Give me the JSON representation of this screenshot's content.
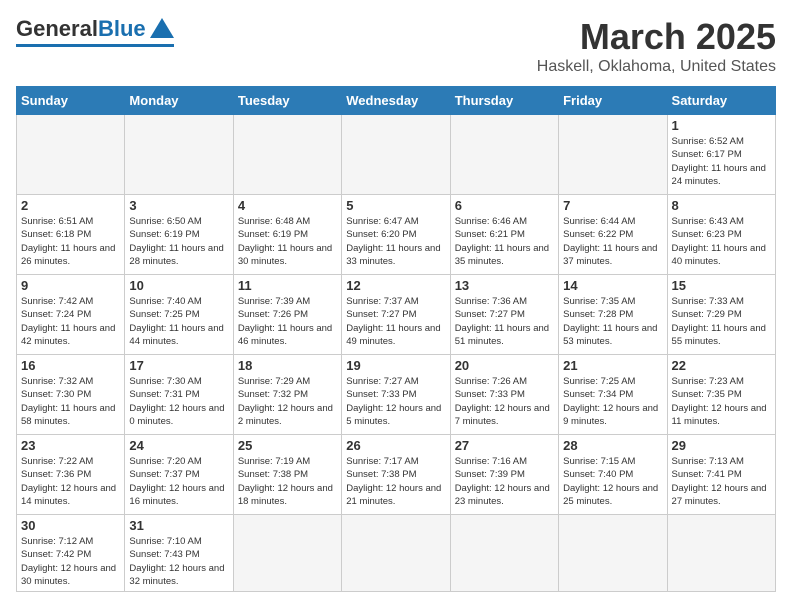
{
  "logo": {
    "general": "General",
    "blue": "Blue"
  },
  "title": {
    "month_year": "March 2025",
    "location": "Haskell, Oklahoma, United States"
  },
  "weekdays": [
    "Sunday",
    "Monday",
    "Tuesday",
    "Wednesday",
    "Thursday",
    "Friday",
    "Saturday"
  ],
  "weeks": [
    [
      {
        "day": "",
        "info": ""
      },
      {
        "day": "",
        "info": ""
      },
      {
        "day": "",
        "info": ""
      },
      {
        "day": "",
        "info": ""
      },
      {
        "day": "",
        "info": ""
      },
      {
        "day": "",
        "info": ""
      },
      {
        "day": "1",
        "info": "Sunrise: 6:52 AM\nSunset: 6:17 PM\nDaylight: 11 hours and 24 minutes."
      }
    ],
    [
      {
        "day": "2",
        "info": "Sunrise: 6:51 AM\nSunset: 6:18 PM\nDaylight: 11 hours and 26 minutes."
      },
      {
        "day": "3",
        "info": "Sunrise: 6:50 AM\nSunset: 6:19 PM\nDaylight: 11 hours and 28 minutes."
      },
      {
        "day": "4",
        "info": "Sunrise: 6:48 AM\nSunset: 6:19 PM\nDaylight: 11 hours and 30 minutes."
      },
      {
        "day": "5",
        "info": "Sunrise: 6:47 AM\nSunset: 6:20 PM\nDaylight: 11 hours and 33 minutes."
      },
      {
        "day": "6",
        "info": "Sunrise: 6:46 AM\nSunset: 6:21 PM\nDaylight: 11 hours and 35 minutes."
      },
      {
        "day": "7",
        "info": "Sunrise: 6:44 AM\nSunset: 6:22 PM\nDaylight: 11 hours and 37 minutes."
      },
      {
        "day": "8",
        "info": "Sunrise: 6:43 AM\nSunset: 6:23 PM\nDaylight: 11 hours and 40 minutes."
      }
    ],
    [
      {
        "day": "9",
        "info": "Sunrise: 7:42 AM\nSunset: 7:24 PM\nDaylight: 11 hours and 42 minutes."
      },
      {
        "day": "10",
        "info": "Sunrise: 7:40 AM\nSunset: 7:25 PM\nDaylight: 11 hours and 44 minutes."
      },
      {
        "day": "11",
        "info": "Sunrise: 7:39 AM\nSunset: 7:26 PM\nDaylight: 11 hours and 46 minutes."
      },
      {
        "day": "12",
        "info": "Sunrise: 7:37 AM\nSunset: 7:27 PM\nDaylight: 11 hours and 49 minutes."
      },
      {
        "day": "13",
        "info": "Sunrise: 7:36 AM\nSunset: 7:27 PM\nDaylight: 11 hours and 51 minutes."
      },
      {
        "day": "14",
        "info": "Sunrise: 7:35 AM\nSunset: 7:28 PM\nDaylight: 11 hours and 53 minutes."
      },
      {
        "day": "15",
        "info": "Sunrise: 7:33 AM\nSunset: 7:29 PM\nDaylight: 11 hours and 55 minutes."
      }
    ],
    [
      {
        "day": "16",
        "info": "Sunrise: 7:32 AM\nSunset: 7:30 PM\nDaylight: 11 hours and 58 minutes."
      },
      {
        "day": "17",
        "info": "Sunrise: 7:30 AM\nSunset: 7:31 PM\nDaylight: 12 hours and 0 minutes."
      },
      {
        "day": "18",
        "info": "Sunrise: 7:29 AM\nSunset: 7:32 PM\nDaylight: 12 hours and 2 minutes."
      },
      {
        "day": "19",
        "info": "Sunrise: 7:27 AM\nSunset: 7:33 PM\nDaylight: 12 hours and 5 minutes."
      },
      {
        "day": "20",
        "info": "Sunrise: 7:26 AM\nSunset: 7:33 PM\nDaylight: 12 hours and 7 minutes."
      },
      {
        "day": "21",
        "info": "Sunrise: 7:25 AM\nSunset: 7:34 PM\nDaylight: 12 hours and 9 minutes."
      },
      {
        "day": "22",
        "info": "Sunrise: 7:23 AM\nSunset: 7:35 PM\nDaylight: 12 hours and 11 minutes."
      }
    ],
    [
      {
        "day": "23",
        "info": "Sunrise: 7:22 AM\nSunset: 7:36 PM\nDaylight: 12 hours and 14 minutes."
      },
      {
        "day": "24",
        "info": "Sunrise: 7:20 AM\nSunset: 7:37 PM\nDaylight: 12 hours and 16 minutes."
      },
      {
        "day": "25",
        "info": "Sunrise: 7:19 AM\nSunset: 7:38 PM\nDaylight: 12 hours and 18 minutes."
      },
      {
        "day": "26",
        "info": "Sunrise: 7:17 AM\nSunset: 7:38 PM\nDaylight: 12 hours and 21 minutes."
      },
      {
        "day": "27",
        "info": "Sunrise: 7:16 AM\nSunset: 7:39 PM\nDaylight: 12 hours and 23 minutes."
      },
      {
        "day": "28",
        "info": "Sunrise: 7:15 AM\nSunset: 7:40 PM\nDaylight: 12 hours and 25 minutes."
      },
      {
        "day": "29",
        "info": "Sunrise: 7:13 AM\nSunset: 7:41 PM\nDaylight: 12 hours and 27 minutes."
      }
    ],
    [
      {
        "day": "30",
        "info": "Sunrise: 7:12 AM\nSunset: 7:42 PM\nDaylight: 12 hours and 30 minutes."
      },
      {
        "day": "31",
        "info": "Sunrise: 7:10 AM\nSunset: 7:43 PM\nDaylight: 12 hours and 32 minutes."
      },
      {
        "day": "",
        "info": ""
      },
      {
        "day": "",
        "info": ""
      },
      {
        "day": "",
        "info": ""
      },
      {
        "day": "",
        "info": ""
      },
      {
        "day": "",
        "info": ""
      }
    ]
  ]
}
